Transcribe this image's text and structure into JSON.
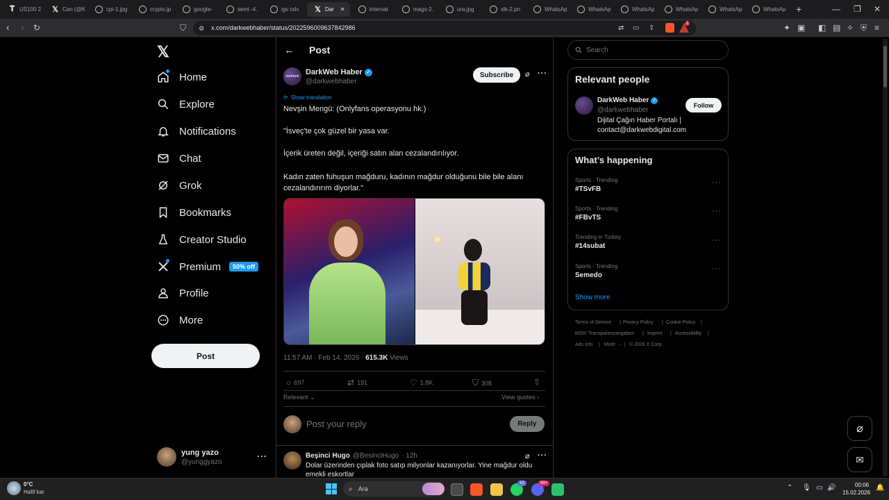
{
  "browser": {
    "tabs": [
      {
        "label": "US100 2"
      },
      {
        "label": "Can (@K"
      },
      {
        "label": "cpi-1.jpg"
      },
      {
        "label": "crypto.jp"
      },
      {
        "label": "google-"
      },
      {
        "label": "semi -4."
      },
      {
        "label": "igv ndx"
      },
      {
        "label": "Dar"
      },
      {
        "label": "internat"
      },
      {
        "label": "mags-2."
      },
      {
        "label": "ura.jpg"
      },
      {
        "label": "xlk-2.pn"
      },
      {
        "label": "WhatsAp"
      },
      {
        "label": "WhatsAp"
      },
      {
        "label": "WhatsAp"
      },
      {
        "label": "WhatsAp"
      },
      {
        "label": "WhatsAp"
      },
      {
        "label": "WhatsAp"
      }
    ],
    "url": "x.com/darkwebhaber/status/2022596009637842986",
    "shield_badge": "2",
    "accent": "#fb542b"
  },
  "sidebar": {
    "items": [
      {
        "label": "Home"
      },
      {
        "label": "Explore"
      },
      {
        "label": "Notifications"
      },
      {
        "label": "Chat"
      },
      {
        "label": "Grok"
      },
      {
        "label": "Bookmarks"
      },
      {
        "label": "Creator Studio"
      },
      {
        "label": "Premium"
      },
      {
        "label": "Profile"
      },
      {
        "label": "More"
      }
    ],
    "premium_badge": "50% off",
    "post_button": "Post",
    "account": {
      "name": "yung yazo",
      "handle": "@yunggyazo"
    }
  },
  "post": {
    "header_title": "Post",
    "author": {
      "name": "DarkWeb Haber",
      "handle": "@darkwebhaber",
      "avatar_text": "darkweb"
    },
    "subscribe_label": "Subscribe",
    "show_translation": "Show translation",
    "text": [
      "Nevşin Mengü: (Onlyfans operasyonu hk.)",
      "\"İsveç'te çok güzel bir yasa var.",
      "İçerik üreten değil, içeriği satın alan cezalandırılıyor.",
      "Kadın zaten fuhuşun mağduru, kadının mağdur olduğunu bile bile alanı cezalandırırım diyorlar.\""
    ],
    "time": "11:57 AM · Feb 14, 2026 · ",
    "views_count": "615.3K",
    "views_label": " Views",
    "stats": {
      "replies": "697",
      "reposts": "191",
      "likes": "1.8K",
      "bookmarks": "308"
    },
    "sort_label": "Relevant",
    "view_quotes": "View quotes",
    "reply_placeholder": "Post your reply",
    "reply_button": "Reply"
  },
  "reply": {
    "name": "Beşinci Hugo",
    "handle": "@BesinciHugo",
    "time": "· 12h",
    "text_1": "Dolar üzerinden çıplak foto satıp milyonlar kazanıyorlar. Yine mağdur oldu",
    "text_2": "emekli eskortlar"
  },
  "right": {
    "search_placeholder": "Search",
    "relevant_title": "Relevant people",
    "person": {
      "name": "DarkWeb Haber",
      "handle": "@darkwebhaber",
      "bio_1": "Dijital Çağın Haber Portalı |",
      "bio_2": "contact@darkwebdigital.com",
      "follow": "Follow"
    },
    "happening_title": "What’s happening",
    "trends": [
      {
        "category": "Sports · Trending",
        "title": "#TSvFB"
      },
      {
        "category": "Sports · Trending",
        "title": "#FBvTS"
      },
      {
        "category": "Trending in Turkey",
        "title": "#14subat"
      },
      {
        "category": "Sports · Trending",
        "title": "Semedo"
      }
    ],
    "show_more": "Show more",
    "footer": [
      "Terms of Service",
      "Privacy Policy",
      "Cookie Policy",
      "MStV Transparenzangaben",
      "Imprint",
      "Accessibility",
      "Ads info",
      "More ···",
      "© 2026 X Corp."
    ]
  },
  "taskbar": {
    "weather_temp": "0°C",
    "weather_desc": "Hafif kar",
    "search_label": "Ara",
    "badge_1": "10",
    "badge_2": "99+",
    "time": "00:06",
    "date": "15.02.2026"
  },
  "colors": {
    "x_blue": "#1d9bf0",
    "bg": "#000000",
    "border": "#2f3336"
  }
}
